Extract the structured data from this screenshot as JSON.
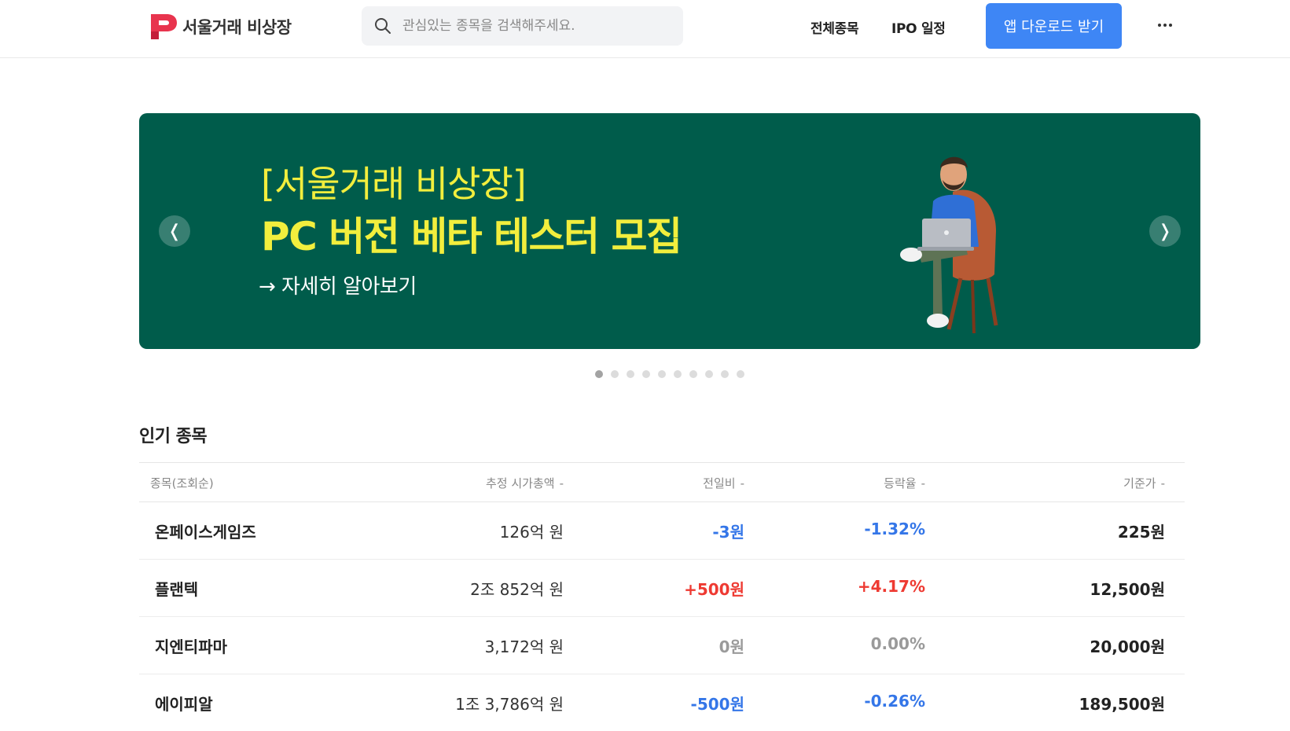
{
  "header": {
    "logo_text": "서울거래 비상장",
    "search_placeholder": "관심있는 종목을 검색해주세요.",
    "nav": [
      "전체종목",
      "IPO 일정"
    ],
    "download_label": "앱 다운로드 받기"
  },
  "banner": {
    "line1": "[서울거래 비상장]",
    "line2": "PC 버전 베타 테스터 모집",
    "link": "→ 자세히 알아보기",
    "prev": "❬",
    "next": "❭",
    "slide_count": 10,
    "active_slide": 1
  },
  "popular": {
    "title": "인기 종목",
    "columns": {
      "name": "종목(조회순)",
      "market_cap": "추정 시가총액",
      "diff": "전일비",
      "rate": "등락율",
      "price": "기준가",
      "sort_mark": "-"
    },
    "rows": [
      {
        "name": "온페이스게임즈",
        "market_cap": "126억 원",
        "diff": "-3원",
        "rate": "-1.32%",
        "price": "225원",
        "trend": "down"
      },
      {
        "name": "플랜텍",
        "market_cap": "2조 852억 원",
        "diff": "+500원",
        "rate": "+4.17%",
        "price": "12,500원",
        "trend": "up"
      },
      {
        "name": "지엔티파마",
        "market_cap": "3,172억 원",
        "diff": "0원",
        "rate": "0.00%",
        "price": "20,000원",
        "trend": "flat"
      },
      {
        "name": "에이피알",
        "market_cap": "1조 3,786억 원",
        "diff": "-500원",
        "rate": "-0.26%",
        "price": "189,500원",
        "trend": "down"
      }
    ]
  },
  "colors": {
    "banner_bg": "#005c4b",
    "banner_text": "#f2ee3d",
    "accent_blue": "#3e86f5",
    "down": "#3476e8",
    "up": "#ee3a32",
    "flat": "#9a9a9a"
  }
}
